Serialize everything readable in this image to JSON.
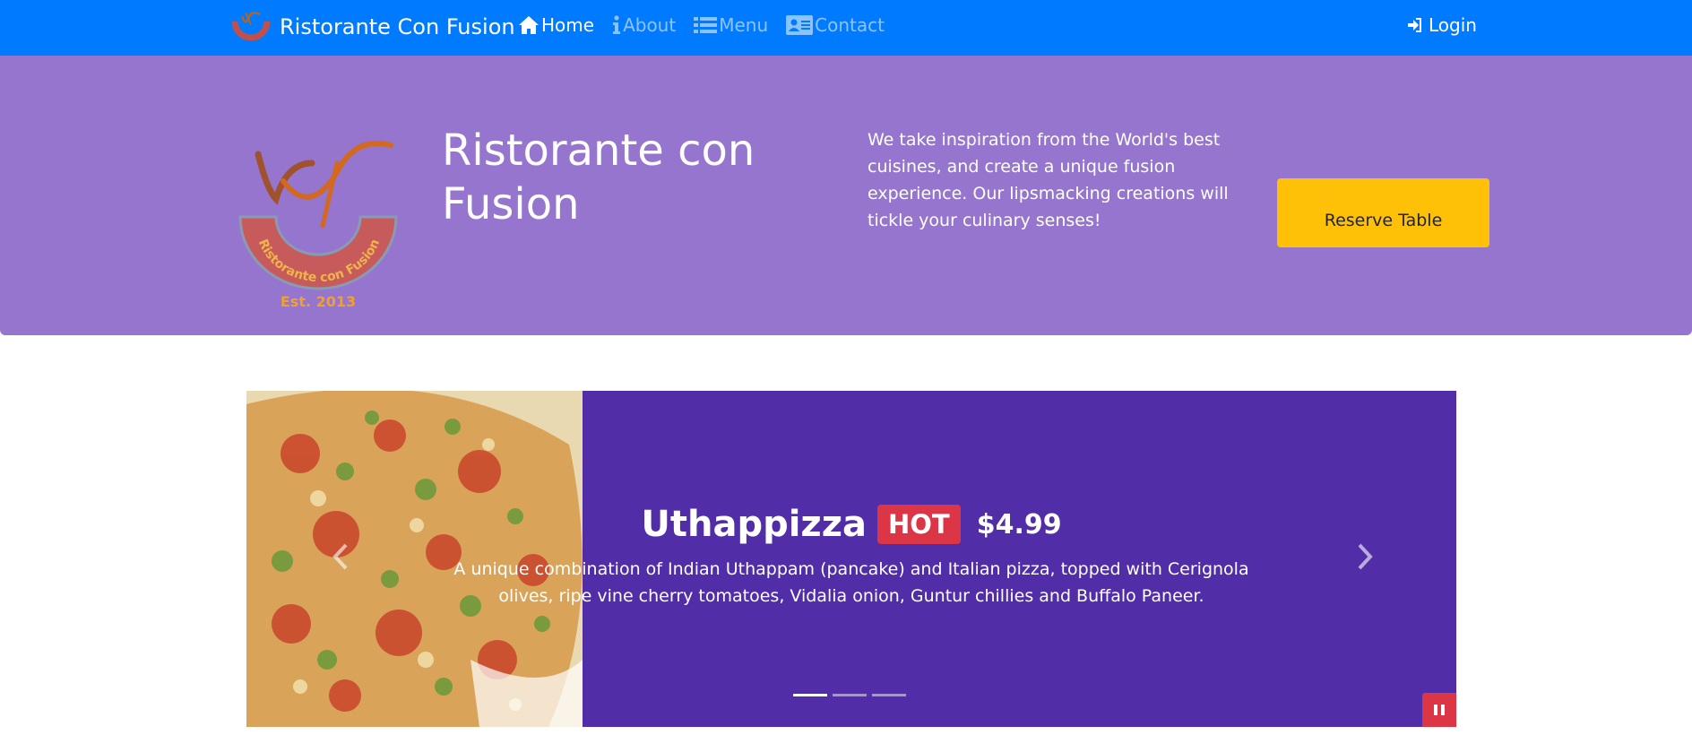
{
  "navbar": {
    "brand": "Ristorante Con Fusion",
    "links": [
      {
        "label": "Home",
        "icon": "home-icon",
        "active": true
      },
      {
        "label": "About",
        "icon": "info-icon",
        "active": false
      },
      {
        "label": "Menu",
        "icon": "list-icon",
        "active": false
      },
      {
        "label": "Contact",
        "icon": "address-card-icon",
        "active": false
      }
    ],
    "login_label": "Login",
    "login_icon": "sign-in-icon"
  },
  "jumbotron": {
    "title": "Ristorante con Fusion",
    "logo_text": "Ristorante con Fusion",
    "logo_est": "Est. 2013",
    "description": "We take inspiration from the World's best cuisines, and create a unique fusion experience. Our lipsmacking creations will tickle your culinary senses!",
    "reserve_label": "Reserve Table"
  },
  "carousel": {
    "dish_name": "Uthappizza",
    "badge": "HOT",
    "price": "$4.99",
    "description": "A unique combination of Indian Uthappam (pancake) and Italian pizza, topped with Cerignola olives, ripe vine cherry tomatoes, Vidalia onion, Guntur chillies and Buffalo Paneer.",
    "slide_count": 3,
    "active_slide": 0
  },
  "colors": {
    "navbar": "#007bff",
    "jumbotron": "#9575cd",
    "carousel": "#512da8",
    "reserve_button": "#ffc107",
    "badge": "#dc3545"
  }
}
